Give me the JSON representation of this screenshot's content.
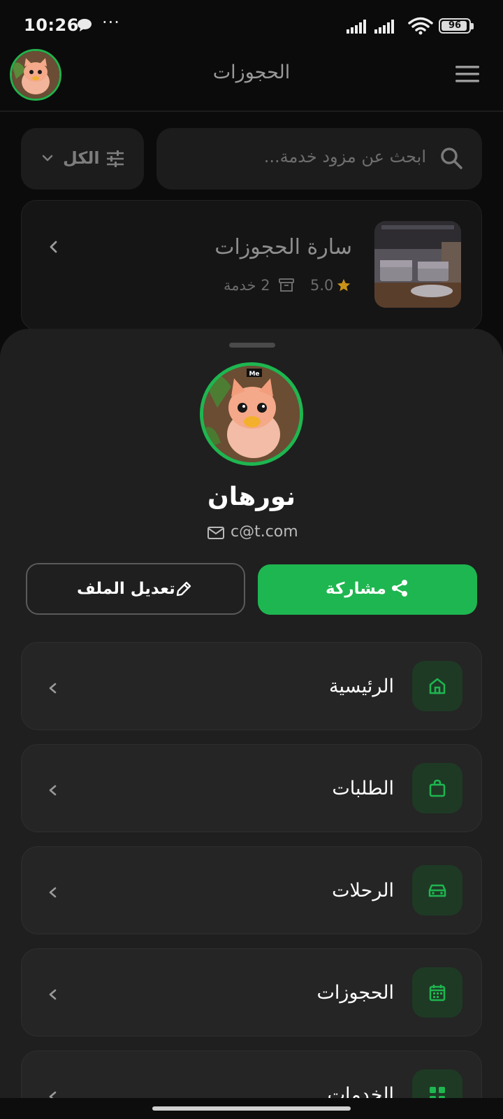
{
  "status_bar": {
    "time": "10:26",
    "dots": "···",
    "battery": "96",
    "battery_level_percent": 96
  },
  "header": {
    "title": "الحجوزات"
  },
  "search": {
    "placeholder": "ابحث عن مزود خدمة..."
  },
  "filter": {
    "label": "الكل"
  },
  "provider": {
    "name": "سارة الحجوزات",
    "rating": "5.0",
    "services": "2 خدمة"
  },
  "profile": {
    "name": "نورهان",
    "email": "c@t.com",
    "avatar_badge": "Me"
  },
  "actions": {
    "share_label": "مشاركة",
    "edit_label": "تعديل الملف"
  },
  "nav": [
    {
      "label": "الرئيسية",
      "icon": "home-icon"
    },
    {
      "label": "الطلبات",
      "icon": "shopping-bag-icon"
    },
    {
      "label": "الرحلات",
      "icon": "car-icon"
    },
    {
      "label": "الحجوزات",
      "icon": "calendar-icon"
    },
    {
      "label": "الخدمات",
      "icon": "grid-icon"
    }
  ],
  "colors": {
    "accent": "#1eb650",
    "background": "#0b0b0b",
    "sheet": "#1f1f1f",
    "star": "#c9931a"
  }
}
